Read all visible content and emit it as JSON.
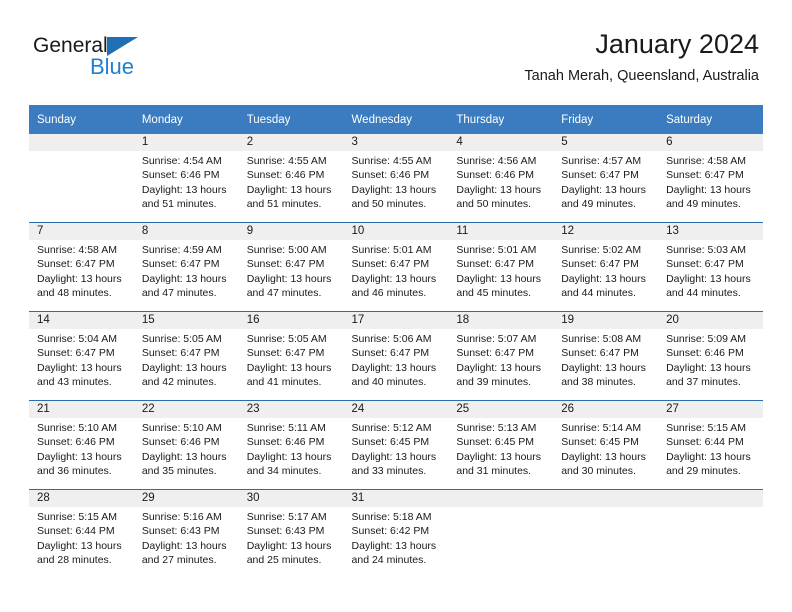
{
  "brand": {
    "name_dark": "General",
    "name_blue": "Blue",
    "accent_blue": "#1f7fd0",
    "triangle_blue": "#1f6fb5"
  },
  "header": {
    "title": "January 2024",
    "subtitle": "Tanah Merah, Queensland, Australia"
  },
  "theme": {
    "header_row_bg": "#3a7cbf",
    "row_divider": "#2c6ca8",
    "daynum_band_bg": "#efefef"
  },
  "weekdays": [
    "Sunday",
    "Monday",
    "Tuesday",
    "Wednesday",
    "Thursday",
    "Friday",
    "Saturday"
  ],
  "labels": {
    "sunrise_prefix": "Sunrise:",
    "sunset_prefix": "Sunset:",
    "daylight_prefix": "Daylight:"
  },
  "weeks": [
    [
      {
        "day": "",
        "sunrise": "",
        "sunset": "",
        "daylight_line1": "",
        "daylight_line2": ""
      },
      {
        "day": "1",
        "sunrise": "Sunrise: 4:54 AM",
        "sunset": "Sunset: 6:46 PM",
        "daylight_line1": "Daylight: 13 hours",
        "daylight_line2": "and 51 minutes."
      },
      {
        "day": "2",
        "sunrise": "Sunrise: 4:55 AM",
        "sunset": "Sunset: 6:46 PM",
        "daylight_line1": "Daylight: 13 hours",
        "daylight_line2": "and 51 minutes."
      },
      {
        "day": "3",
        "sunrise": "Sunrise: 4:55 AM",
        "sunset": "Sunset: 6:46 PM",
        "daylight_line1": "Daylight: 13 hours",
        "daylight_line2": "and 50 minutes."
      },
      {
        "day": "4",
        "sunrise": "Sunrise: 4:56 AM",
        "sunset": "Sunset: 6:46 PM",
        "daylight_line1": "Daylight: 13 hours",
        "daylight_line2": "and 50 minutes."
      },
      {
        "day": "5",
        "sunrise": "Sunrise: 4:57 AM",
        "sunset": "Sunset: 6:47 PM",
        "daylight_line1": "Daylight: 13 hours",
        "daylight_line2": "and 49 minutes."
      },
      {
        "day": "6",
        "sunrise": "Sunrise: 4:58 AM",
        "sunset": "Sunset: 6:47 PM",
        "daylight_line1": "Daylight: 13 hours",
        "daylight_line2": "and 49 minutes."
      }
    ],
    [
      {
        "day": "7",
        "sunrise": "Sunrise: 4:58 AM",
        "sunset": "Sunset: 6:47 PM",
        "daylight_line1": "Daylight: 13 hours",
        "daylight_line2": "and 48 minutes."
      },
      {
        "day": "8",
        "sunrise": "Sunrise: 4:59 AM",
        "sunset": "Sunset: 6:47 PM",
        "daylight_line1": "Daylight: 13 hours",
        "daylight_line2": "and 47 minutes."
      },
      {
        "day": "9",
        "sunrise": "Sunrise: 5:00 AM",
        "sunset": "Sunset: 6:47 PM",
        "daylight_line1": "Daylight: 13 hours",
        "daylight_line2": "and 47 minutes."
      },
      {
        "day": "10",
        "sunrise": "Sunrise: 5:01 AM",
        "sunset": "Sunset: 6:47 PM",
        "daylight_line1": "Daylight: 13 hours",
        "daylight_line2": "and 46 minutes."
      },
      {
        "day": "11",
        "sunrise": "Sunrise: 5:01 AM",
        "sunset": "Sunset: 6:47 PM",
        "daylight_line1": "Daylight: 13 hours",
        "daylight_line2": "and 45 minutes."
      },
      {
        "day": "12",
        "sunrise": "Sunrise: 5:02 AM",
        "sunset": "Sunset: 6:47 PM",
        "daylight_line1": "Daylight: 13 hours",
        "daylight_line2": "and 44 minutes."
      },
      {
        "day": "13",
        "sunrise": "Sunrise: 5:03 AM",
        "sunset": "Sunset: 6:47 PM",
        "daylight_line1": "Daylight: 13 hours",
        "daylight_line2": "and 44 minutes."
      }
    ],
    [
      {
        "day": "14",
        "sunrise": "Sunrise: 5:04 AM",
        "sunset": "Sunset: 6:47 PM",
        "daylight_line1": "Daylight: 13 hours",
        "daylight_line2": "and 43 minutes."
      },
      {
        "day": "15",
        "sunrise": "Sunrise: 5:05 AM",
        "sunset": "Sunset: 6:47 PM",
        "daylight_line1": "Daylight: 13 hours",
        "daylight_line2": "and 42 minutes."
      },
      {
        "day": "16",
        "sunrise": "Sunrise: 5:05 AM",
        "sunset": "Sunset: 6:47 PM",
        "daylight_line1": "Daylight: 13 hours",
        "daylight_line2": "and 41 minutes."
      },
      {
        "day": "17",
        "sunrise": "Sunrise: 5:06 AM",
        "sunset": "Sunset: 6:47 PM",
        "daylight_line1": "Daylight: 13 hours",
        "daylight_line2": "and 40 minutes."
      },
      {
        "day": "18",
        "sunrise": "Sunrise: 5:07 AM",
        "sunset": "Sunset: 6:47 PM",
        "daylight_line1": "Daylight: 13 hours",
        "daylight_line2": "and 39 minutes."
      },
      {
        "day": "19",
        "sunrise": "Sunrise: 5:08 AM",
        "sunset": "Sunset: 6:47 PM",
        "daylight_line1": "Daylight: 13 hours",
        "daylight_line2": "and 38 minutes."
      },
      {
        "day": "20",
        "sunrise": "Sunrise: 5:09 AM",
        "sunset": "Sunset: 6:46 PM",
        "daylight_line1": "Daylight: 13 hours",
        "daylight_line2": "and 37 minutes."
      }
    ],
    [
      {
        "day": "21",
        "sunrise": "Sunrise: 5:10 AM",
        "sunset": "Sunset: 6:46 PM",
        "daylight_line1": "Daylight: 13 hours",
        "daylight_line2": "and 36 minutes."
      },
      {
        "day": "22",
        "sunrise": "Sunrise: 5:10 AM",
        "sunset": "Sunset: 6:46 PM",
        "daylight_line1": "Daylight: 13 hours",
        "daylight_line2": "and 35 minutes."
      },
      {
        "day": "23",
        "sunrise": "Sunrise: 5:11 AM",
        "sunset": "Sunset: 6:46 PM",
        "daylight_line1": "Daylight: 13 hours",
        "daylight_line2": "and 34 minutes."
      },
      {
        "day": "24",
        "sunrise": "Sunrise: 5:12 AM",
        "sunset": "Sunset: 6:45 PM",
        "daylight_line1": "Daylight: 13 hours",
        "daylight_line2": "and 33 minutes."
      },
      {
        "day": "25",
        "sunrise": "Sunrise: 5:13 AM",
        "sunset": "Sunset: 6:45 PM",
        "daylight_line1": "Daylight: 13 hours",
        "daylight_line2": "and 31 minutes."
      },
      {
        "day": "26",
        "sunrise": "Sunrise: 5:14 AM",
        "sunset": "Sunset: 6:45 PM",
        "daylight_line1": "Daylight: 13 hours",
        "daylight_line2": "and 30 minutes."
      },
      {
        "day": "27",
        "sunrise": "Sunrise: 5:15 AM",
        "sunset": "Sunset: 6:44 PM",
        "daylight_line1": "Daylight: 13 hours",
        "daylight_line2": "and 29 minutes."
      }
    ],
    [
      {
        "day": "28",
        "sunrise": "Sunrise: 5:15 AM",
        "sunset": "Sunset: 6:44 PM",
        "daylight_line1": "Daylight: 13 hours",
        "daylight_line2": "and 28 minutes."
      },
      {
        "day": "29",
        "sunrise": "Sunrise: 5:16 AM",
        "sunset": "Sunset: 6:43 PM",
        "daylight_line1": "Daylight: 13 hours",
        "daylight_line2": "and 27 minutes."
      },
      {
        "day": "30",
        "sunrise": "Sunrise: 5:17 AM",
        "sunset": "Sunset: 6:43 PM",
        "daylight_line1": "Daylight: 13 hours",
        "daylight_line2": "and 25 minutes."
      },
      {
        "day": "31",
        "sunrise": "Sunrise: 5:18 AM",
        "sunset": "Sunset: 6:42 PM",
        "daylight_line1": "Daylight: 13 hours",
        "daylight_line2": "and 24 minutes."
      },
      {
        "day": "",
        "sunrise": "",
        "sunset": "",
        "daylight_line1": "",
        "daylight_line2": ""
      },
      {
        "day": "",
        "sunrise": "",
        "sunset": "",
        "daylight_line1": "",
        "daylight_line2": ""
      },
      {
        "day": "",
        "sunrise": "",
        "sunset": "",
        "daylight_line1": "",
        "daylight_line2": ""
      }
    ]
  ]
}
